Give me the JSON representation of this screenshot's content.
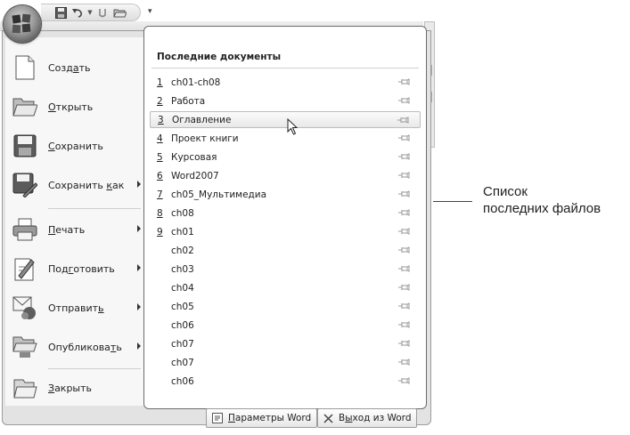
{
  "menu": {
    "left_items": [
      {
        "pre": "Созд",
        "ul": "а",
        "post": "ть",
        "icon": "new-document-icon",
        "submenu": false
      },
      {
        "pre": "",
        "ul": "О",
        "post": "ткрыть",
        "icon": "open-folder-icon",
        "submenu": false
      },
      {
        "pre": "",
        "ul": "С",
        "post": "охранить",
        "icon": "save-icon",
        "submenu": false
      },
      {
        "pre": "Сохранить ",
        "ul": "к",
        "post": "ак",
        "icon": "save-as-icon",
        "submenu": true
      },
      {
        "pre": "",
        "ul": "П",
        "post": "ечать",
        "icon": "printer-icon",
        "submenu": true
      },
      {
        "pre": "Под",
        "ul": "г",
        "post": "отовить",
        "icon": "prepare-icon",
        "submenu": true
      },
      {
        "pre": "Отправит",
        "ul": "ь",
        "post": "",
        "icon": "send-icon",
        "submenu": true
      },
      {
        "pre": "Опубликова",
        "ul": "т",
        "post": "ь",
        "icon": "publish-icon",
        "submenu": true
      },
      {
        "pre": "",
        "ul": "З",
        "post": "акрыть",
        "icon": "close-document-icon",
        "submenu": false
      }
    ]
  },
  "recent": {
    "title": "Последние документы",
    "items": [
      {
        "num": "1",
        "name": "ch01-ch08"
      },
      {
        "num": "2",
        "name": "Работа"
      },
      {
        "num": "3",
        "name": "Оглавление"
      },
      {
        "num": "4",
        "name": "Проект книги"
      },
      {
        "num": "5",
        "name": "Курсовая"
      },
      {
        "num": "6",
        "name": "Word2007"
      },
      {
        "num": "7",
        "name": "ch05_Мультимедиа"
      },
      {
        "num": "8",
        "name": "ch08"
      },
      {
        "num": "9",
        "name": "ch01"
      },
      {
        "num": "",
        "name": "ch02"
      },
      {
        "num": "",
        "name": "ch03"
      },
      {
        "num": "",
        "name": "ch04"
      },
      {
        "num": "",
        "name": "ch05"
      },
      {
        "num": "",
        "name": "ch06"
      },
      {
        "num": "",
        "name": "ch07"
      },
      {
        "num": "",
        "name": "ch07"
      },
      {
        "num": "",
        "name": "ch06"
      }
    ],
    "selected_index": 2
  },
  "buttons": {
    "options": {
      "pre": "",
      "ul": "П",
      "post": "араметры Word"
    },
    "exit": {
      "pre": "В",
      "ul": "ы",
      "post": "ход из Word"
    }
  },
  "callout": {
    "line1": "Список",
    "line2": "последних файлов"
  },
  "colors": {
    "accent": "#6d6d6d",
    "menu_bg": "#e3e3e3",
    "panel_bg": "#f7f7f7"
  }
}
